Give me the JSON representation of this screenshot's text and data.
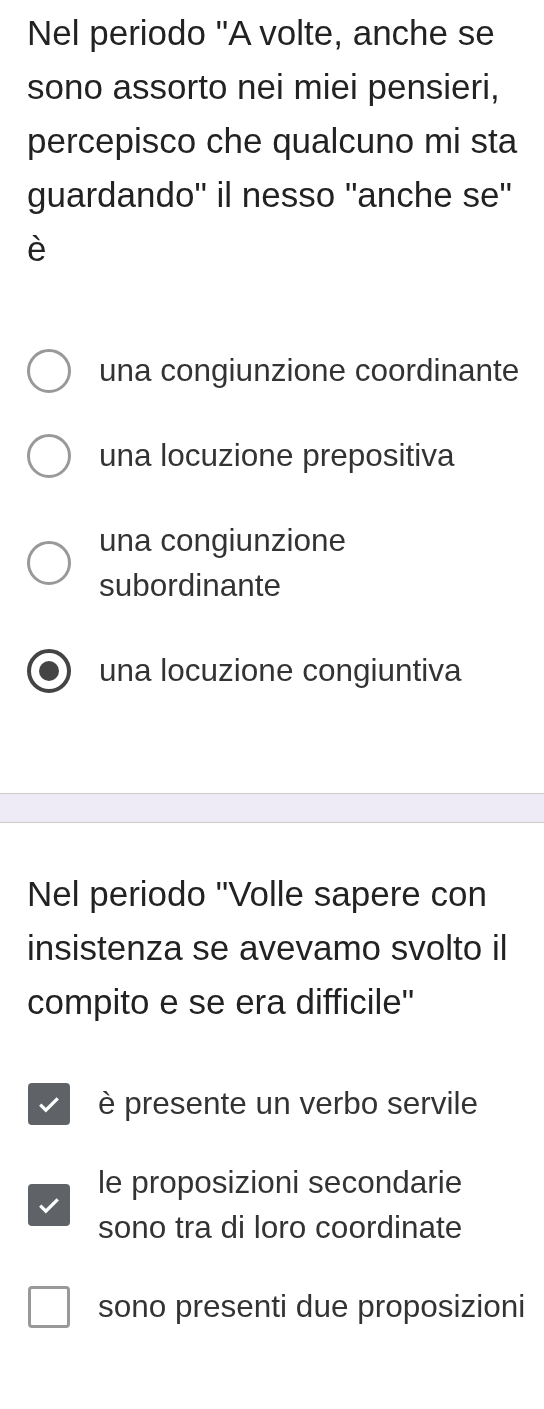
{
  "questions": [
    {
      "kind": "radio",
      "text": "Nel periodo \"A volte, anche se sono assorto nei miei pensieri, percepisco che qualcuno mi sta guardando\" il nesso \"anche se\" è",
      "options": [
        {
          "label": "una congiunzione coordinante",
          "selected": false
        },
        {
          "label": "una locuzione prepositiva",
          "selected": false
        },
        {
          "label": "una congiunzione subordinante",
          "selected": false
        },
        {
          "label": "una locuzione congiuntiva",
          "selected": true
        }
      ]
    },
    {
      "kind": "checkbox",
      "text": "Nel periodo \"Volle sapere con insistenza se avevamo svolto il compito e se era difficile\"",
      "options": [
        {
          "label": "è presente un verbo servile",
          "selected": true
        },
        {
          "label": "le proposizioni secondarie sono tra di loro coordinate",
          "selected": true
        },
        {
          "label": "sono presenti due proposizioni",
          "selected": false
        }
      ]
    }
  ]
}
